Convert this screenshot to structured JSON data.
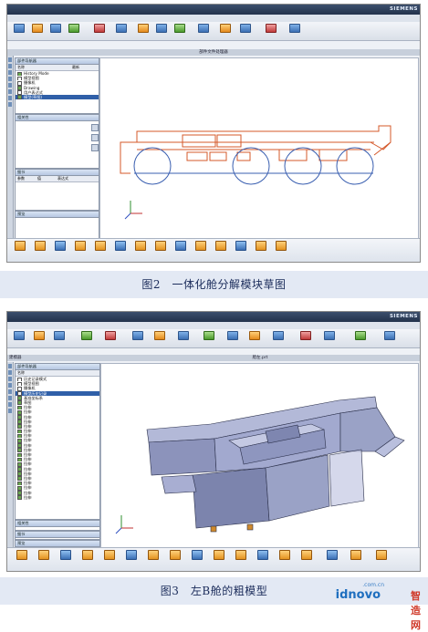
{
  "colors": {
    "sketch_orange": "#d4582a",
    "sketch_blue": "#3a5fb0",
    "model_fill": "#9aa2c6",
    "model_edge": "#2a2f4a",
    "accent": "#2f5fa8"
  },
  "shot1": {
    "siemens_label": "SIEMENS",
    "strip_label": "部件文件处理器",
    "nav_title": "部件导航器",
    "tree_col_name": "名称",
    "tree_col_up": "最新",
    "tree": [
      "History Mode",
      "模型视图",
      "摄像机",
      "Drawing",
      "用户表达式",
      "模型(草图)"
    ],
    "sub1_title": "相关性",
    "sub2_title": "细节",
    "sub2_cols": [
      "参数",
      "值",
      "表达式"
    ],
    "sub3_title": "预览"
  },
  "shot2": {
    "siemens_label": "SIEMENS",
    "left_strip_label": "建模器",
    "strip_label": "舱左.prt",
    "nav_title": "部件导航器",
    "tree_col_name": "名称",
    "tree": [
      "历史记录模式",
      "模型视图",
      "摄像机",
      "模型历史记录",
      "基准坐标系",
      "草图",
      "拉伸",
      "拉伸",
      "拉伸",
      "拉伸",
      "拉伸",
      "拉伸",
      "拉伸",
      "拉伸",
      "拉伸",
      "拉伸",
      "拉伸",
      "拉伸",
      "拉伸",
      "拉伸",
      "拉伸",
      "拉伸",
      "拉伸",
      "拉伸",
      "拉伸",
      "拉伸"
    ],
    "sub1_title": "相关性",
    "sub2_title": "细节",
    "sub3_title": "预览"
  },
  "captions": {
    "fig2": "图2　一体化舱分解模块草图",
    "fig3": "图3　左B舱的粗模型"
  },
  "watermark": {
    "url": ".com.cn",
    "brand": "idnovo",
    "cn": "智造网"
  }
}
